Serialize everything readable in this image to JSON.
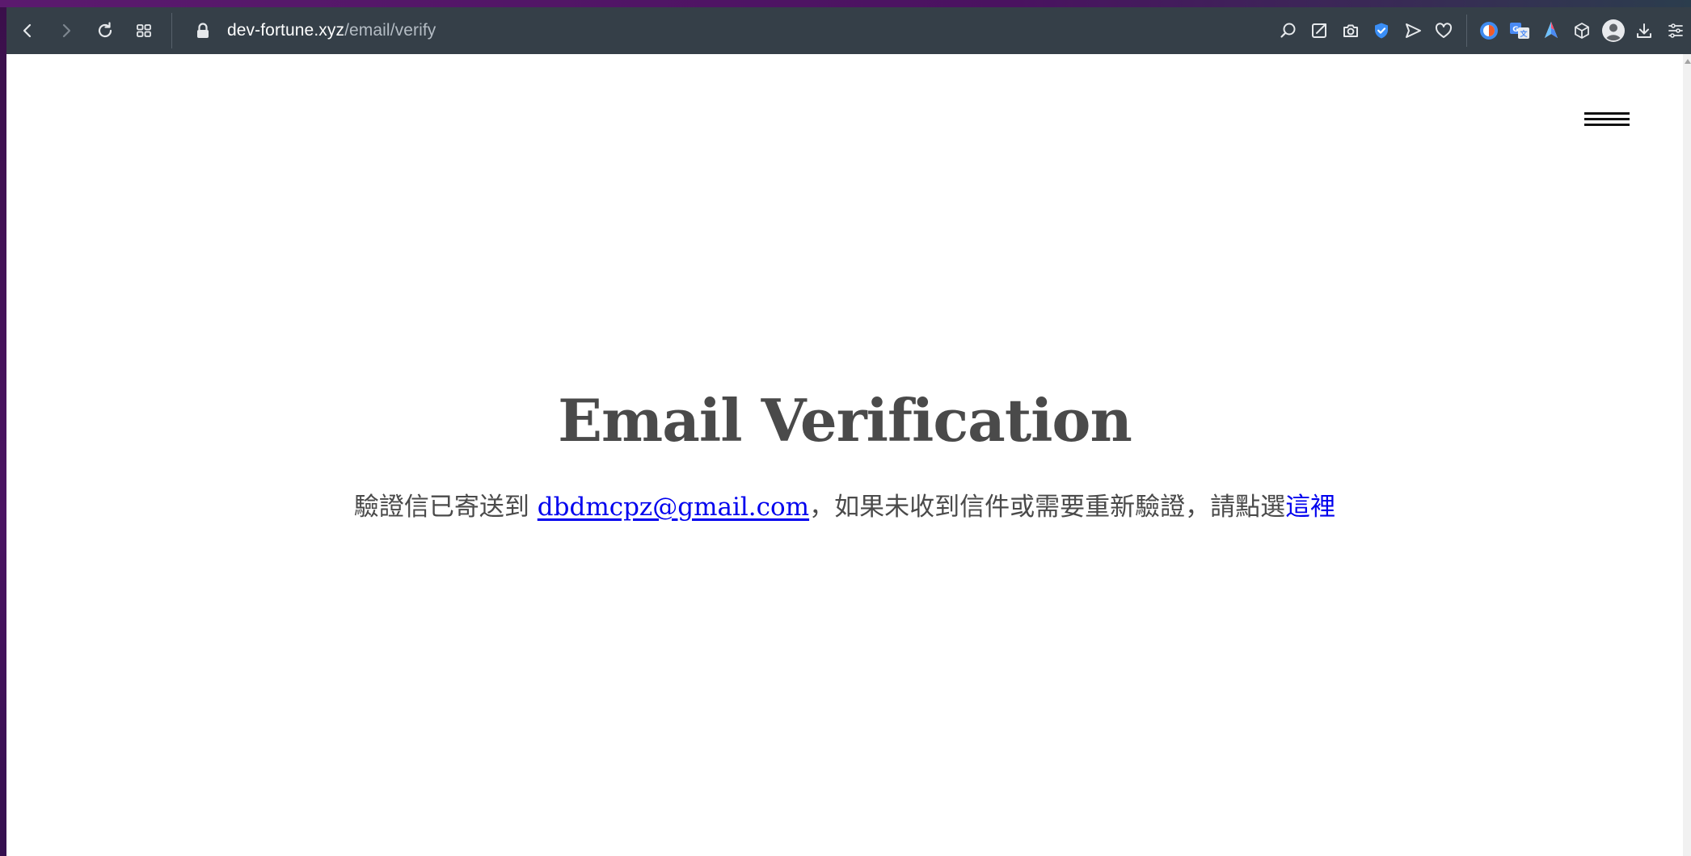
{
  "browser": {
    "url_domain": "dev-fortune.xyz",
    "url_path": "/email/verify",
    "nav_icons": [
      "back-icon",
      "forward-icon",
      "reload-icon",
      "tabs-grid-icon",
      "lock-icon"
    ],
    "toolbar_icons": [
      "search-icon",
      "share-icon",
      "camera-icon",
      "shield-icon",
      "send-icon",
      "heart-icon",
      "extension-icon-1",
      "translate-icon",
      "extension-icon-2",
      "box-icon",
      "profile-icon",
      "download-icon",
      "menu-icon"
    ]
  },
  "page": {
    "title": "Email Verification",
    "message_prefix": "驗證信已寄送到 ",
    "email": "dbdmcpz@gmail.com",
    "message_middle": "，如果未收到信件或需要重新驗證，請點選",
    "resend_link": "這裡"
  },
  "colors": {
    "toolbar_bg": "#353f48",
    "link": "#0000ee",
    "title_text": "#4a4a4a"
  }
}
